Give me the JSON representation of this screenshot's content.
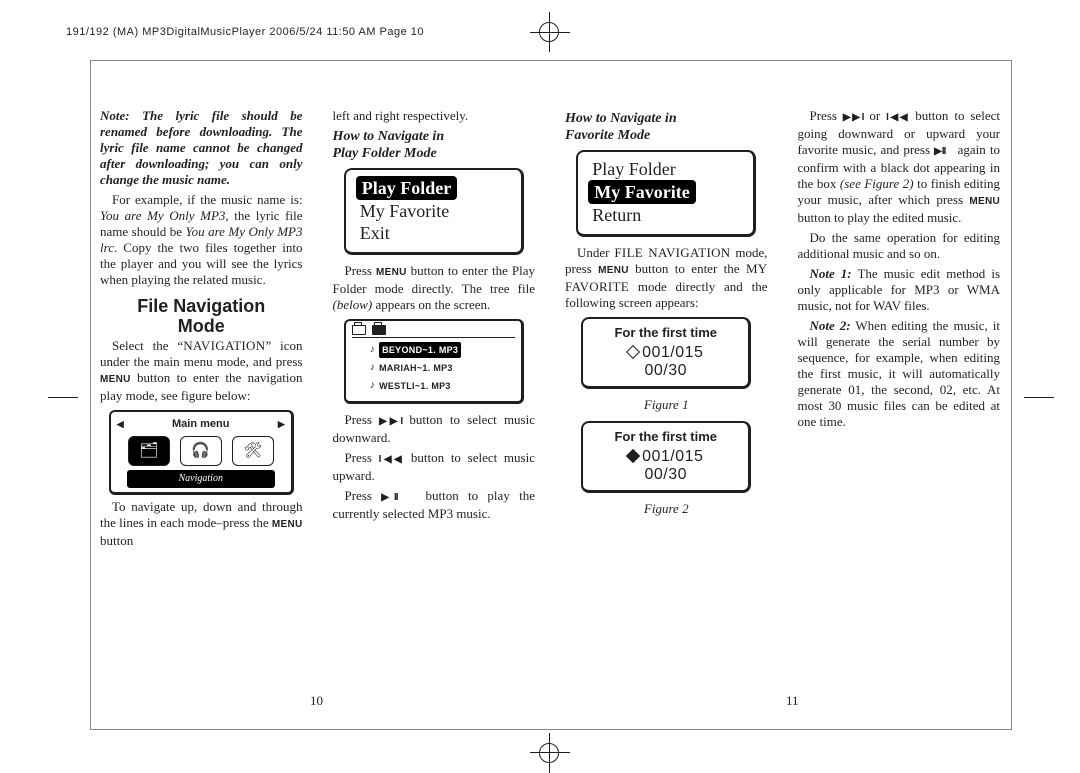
{
  "header": "191/192 (MA) MP3DigitalMusicPlayer  2006/5/24  11:50 AM  Page 10",
  "page_left": "10",
  "page_right": "11",
  "col1": {
    "note": "Note: The lyric file should be renamed before downloading. The lyric file name cannot be changed after downloading; you can only change the music name.",
    "p1a": "For example, if the music name is: ",
    "p1b": "You are My Only MP3",
    "p1c": ", the lyric file name should be ",
    "p1d": "You are My Only MP3 lrc",
    "p1e": ". Copy the two files together into the player and you will see the lyrics when playing the related music.",
    "h2a": "File Navigation",
    "h2b": "Mode",
    "p2a": "Select the “",
    "p2nav": "NAVIGATION",
    "p2b": "” icon under the main menu mode, and press ",
    "p2menu": "MENU",
    "p2c": " button to enter the navigation play mode, see figure below:",
    "screen": {
      "title": "Main menu",
      "label": "Navigation"
    },
    "p3a": "To navigate up, down and through the lines in each mode–press the ",
    "p3menu": "MENU",
    "p3b": " button"
  },
  "col2": {
    "p0": "left and right respectively.",
    "h3a": "How to Navigate in",
    "h3b": "Play Folder Mode",
    "menu": {
      "i1": "Play Folder",
      "i2": "My Favorite",
      "i3": "Exit"
    },
    "p1a": "Press ",
    "p1menu": "MENU",
    "p1b": " button to enter the Play Folder mode directly. The tree file ",
    "p1below": "(below)",
    "p1c": " appears on the screen.",
    "tree": {
      "f1": "BEYOND~1. MP3",
      "f2": "MARIAH~1. MP3",
      "f3": "WESTLI~1. MP3"
    },
    "p2a": "Press ",
    "p2b": " button to select music downward.",
    "p3a": "Press ",
    "p3b": " button to select music upward.",
    "p4a": "Press ",
    "p4b": " button to play the currently selected MP3 music."
  },
  "col3": {
    "h3a": "How to Navigate in",
    "h3b": "Favorite Mode",
    "menu": {
      "i1": "Play Folder",
      "i2": "My Favorite",
      "i3": "Return"
    },
    "p1a": "Under ",
    "p1nav": "FILE NAVIGATION",
    "p1b": " mode, press ",
    "p1menu": "MENU",
    "p1c": " button to enter the ",
    "p1fav": "MY FAVORITE",
    "p1d": " mode directly and the following screen appears:",
    "fig": {
      "title": "For the first time",
      "line1": "001/015",
      "line2": "00/30",
      "cap1": "Figure 1",
      "cap2": "Figure 2"
    }
  },
  "col4": {
    "p1a": "Press ",
    "p1b": " or ",
    "p1c": " button to select going downward or upward your favorite music, and press ",
    "p1d": " again to confirm with a black dot appearing in the box ",
    "p1see": "(see  Figure 2)",
    "p1e": " to finish editing your music, after which press ",
    "p1menu": "MENU",
    "p1f": " button to play the edited music.",
    "p2": "Do the same operation for editing additional music and so on.",
    "n1a": "Note 1:",
    "n1b": " The music edit method is only applicable for MP3 or WMA music, not for WAV files.",
    "n2a": "Note 2:",
    "n2b": " When editing the music, it will generate the serial number by sequence, for example, when editing the first music, it will automatically generate 01, the second, 02, etc. At most 30 music files can be edited at one time."
  }
}
